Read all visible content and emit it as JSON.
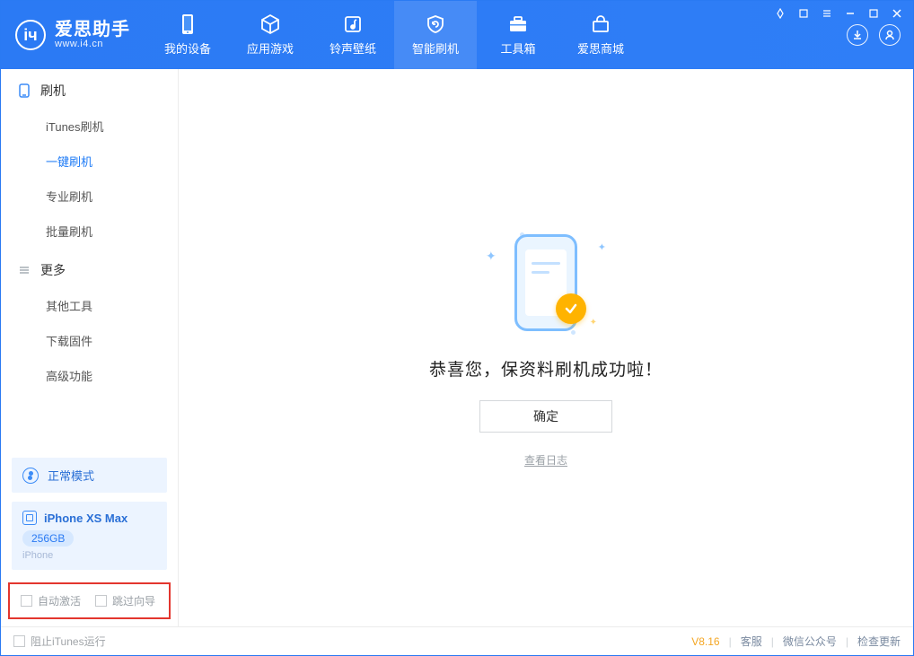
{
  "app": {
    "title": "爱思助手",
    "subtitle": "www.i4.cn"
  },
  "tabs": [
    {
      "id": "device",
      "label": "我的设备"
    },
    {
      "id": "apps",
      "label": "应用游戏"
    },
    {
      "id": "ringtone",
      "label": "铃声壁纸"
    },
    {
      "id": "flash",
      "label": "智能刷机"
    },
    {
      "id": "toolbox",
      "label": "工具箱"
    },
    {
      "id": "store",
      "label": "爱思商城"
    }
  ],
  "sidebar": {
    "group1": {
      "title": "刷机",
      "items": [
        "iTunes刷机",
        "一键刷机",
        "专业刷机",
        "批量刷机"
      ],
      "active_index": 1
    },
    "group2": {
      "title": "更多",
      "items": [
        "其他工具",
        "下载固件",
        "高级功能"
      ]
    }
  },
  "mode": {
    "label": "正常模式"
  },
  "device": {
    "name": "iPhone XS Max",
    "capacity": "256GB",
    "type": "iPhone"
  },
  "options": {
    "auto_activate": "自动激活",
    "skip_guide": "跳过向导"
  },
  "main": {
    "success_text": "恭喜您，保资料刷机成功啦！",
    "confirm_label": "确定",
    "view_log_label": "查看日志"
  },
  "footer": {
    "block_itunes": "阻止iTunes运行",
    "version": "V8.16",
    "links": [
      "客服",
      "微信公众号",
      "检查更新"
    ]
  }
}
